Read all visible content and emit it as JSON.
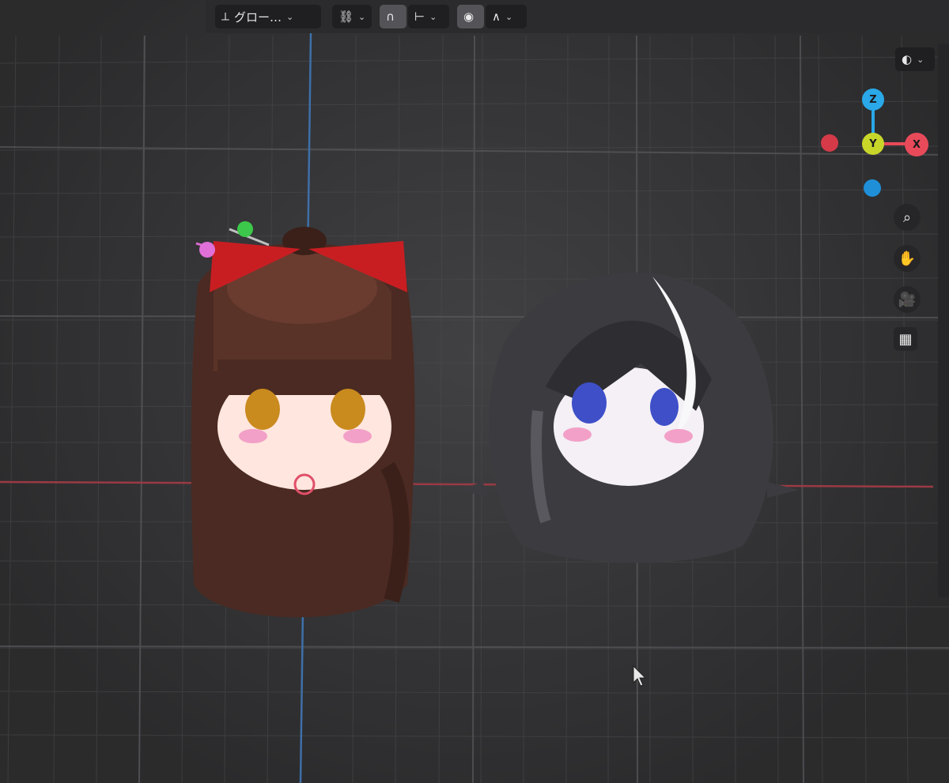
{
  "header": {
    "transform_pivot_label": "グロー…",
    "snap_icon": "snap-magnet-icon",
    "proportional_icon": "proportional-editing-icon",
    "falloff_icon": "falloff-curve-icon"
  },
  "gizmo": {
    "axes": [
      {
        "name": "Z",
        "color": "#2aa8e8"
      },
      {
        "name": "Y",
        "color": "#c8d62a"
      },
      {
        "name": "X",
        "color": "#e84a5a"
      }
    ]
  },
  "nav_tools": [
    {
      "name": "zoom-icon"
    },
    {
      "name": "pan-hand-icon"
    },
    {
      "name": "camera-icon"
    },
    {
      "name": "grid-view-icon"
    }
  ],
  "colors": {
    "grid_line": "#4a4a4d",
    "x_axis_line": "#9a3a44",
    "y_axis_line": "#3f6fa8",
    "left_hair": "#4a2a22",
    "left_bow": "#c81e22",
    "right_hair": "#3c3c40"
  }
}
